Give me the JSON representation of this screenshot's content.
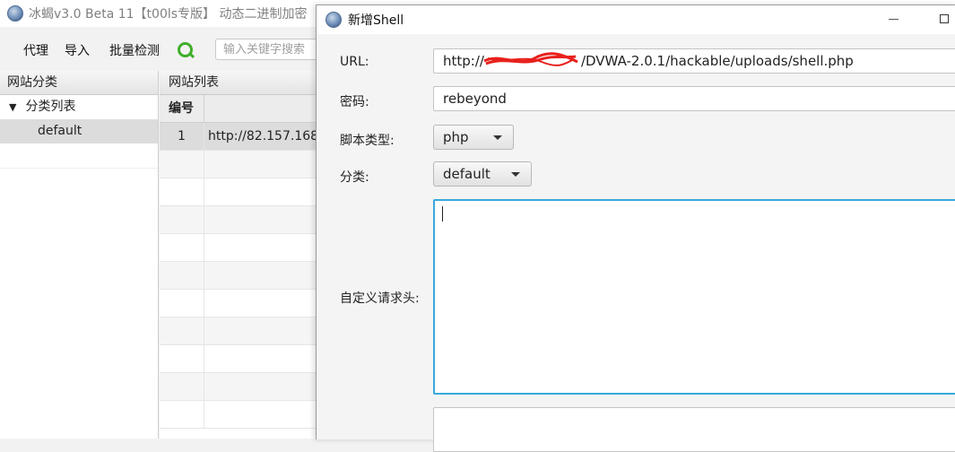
{
  "main_window": {
    "title": "冰蝎v3.0 Beta 11【t00ls专版】 动态二进制加密",
    "toolbar": {
      "proxy": "代理",
      "import": "导入",
      "batch_check": "批量检测"
    },
    "search": {
      "placeholder": "输入关键字搜索"
    },
    "left_panel": {
      "header": "网站分类",
      "tree_root": "分类列表",
      "tree_items": [
        "default"
      ]
    },
    "site_list": {
      "header": "网站列表",
      "col_num": "编号",
      "rows": [
        {
          "num": "1",
          "url": "http://82.157.168"
        }
      ]
    }
  },
  "dialog": {
    "title": "新增Shell",
    "url_label": "URL:",
    "url_value_prefix": "http://",
    "url_value_suffix": "/DVWA-2.0.1/hackable/uploads/shell.php",
    "password_label": "密码:",
    "password_value": "rebeyond",
    "script_type_label": "脚本类型:",
    "script_type_value": "php",
    "category_label": "分类:",
    "category_value": "default",
    "custom_headers_label": "自定义请求头:",
    "custom_headers_value": ""
  },
  "colors": {
    "focus_border": "#38a8dc",
    "search_icon": "#3fae2a",
    "redaction": "#e8201c"
  }
}
